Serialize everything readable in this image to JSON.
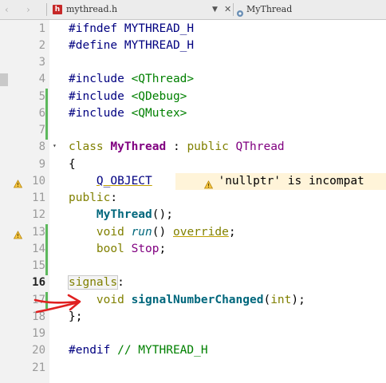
{
  "tab": {
    "back": "‹",
    "forward": "›",
    "file_icon": "h",
    "filename": "mythread.h",
    "dropdown": "▼",
    "close": "✕",
    "symbol": "MyThread"
  },
  "lines": [
    {
      "n": "1",
      "segs": [
        {
          "t": "#ifndef ",
          "c": "pp"
        },
        {
          "t": "MYTHREAD_H",
          "c": "mac"
        }
      ]
    },
    {
      "n": "2",
      "segs": [
        {
          "t": "#define ",
          "c": "pp"
        },
        {
          "t": "MYTHREAD_H",
          "c": "mac"
        }
      ]
    },
    {
      "n": "3",
      "segs": []
    },
    {
      "n": "4",
      "segs": [
        {
          "t": "#include ",
          "c": "pp"
        },
        {
          "t": "<QThread>",
          "c": "inc"
        }
      ]
    },
    {
      "n": "5",
      "segs": [
        {
          "t": "#include ",
          "c": "pp"
        },
        {
          "t": "<QDebug>",
          "c": "inc"
        }
      ]
    },
    {
      "n": "6",
      "segs": [
        {
          "t": "#include ",
          "c": "pp"
        },
        {
          "t": "<QMutex>",
          "c": "inc"
        }
      ]
    },
    {
      "n": "7",
      "segs": []
    },
    {
      "n": "8",
      "fold": "▾",
      "segs": [
        {
          "t": "class ",
          "c": "kw"
        },
        {
          "t": "MyThread",
          "c": "cls"
        },
        {
          "t": " : "
        },
        {
          "t": "public ",
          "c": "kw"
        },
        {
          "t": "QThread",
          "c": "cls2"
        }
      ]
    },
    {
      "n": "9",
      "segs": [
        {
          "t": "{"
        }
      ]
    },
    {
      "n": "10",
      "warn": true,
      "segs": [
        {
          "t": "    "
        },
        {
          "t": "Q_OBJECT",
          "c": "mac",
          "u": true
        }
      ],
      "note": "  'nullptr' is incompat"
    },
    {
      "n": "11",
      "segs": [
        {
          "t": "public",
          "c": "kw"
        },
        {
          "t": ":"
        }
      ]
    },
    {
      "n": "12",
      "segs": [
        {
          "t": "    "
        },
        {
          "t": "MyThread",
          "c": "fn"
        },
        {
          "t": "();"
        }
      ]
    },
    {
      "n": "13",
      "warn": true,
      "segs": [
        {
          "t": "    "
        },
        {
          "t": "void ",
          "c": "kw"
        },
        {
          "t": "run",
          "c": "vfn"
        },
        {
          "t": "() "
        },
        {
          "t": "override",
          "c": "kw",
          "u": true
        },
        {
          "t": ";"
        }
      ]
    },
    {
      "n": "14",
      "segs": [
        {
          "t": "    "
        },
        {
          "t": "bool ",
          "c": "kw"
        },
        {
          "t": "Stop",
          "c": "cls2"
        },
        {
          "t": ";"
        }
      ]
    },
    {
      "n": "15",
      "segs": []
    },
    {
      "n": "16",
      "bold": true,
      "segs": [
        {
          "t": "signals",
          "c": "kw sig"
        },
        {
          "t": ":"
        }
      ]
    },
    {
      "n": "17",
      "segs": [
        {
          "t": "    "
        },
        {
          "t": "void ",
          "c": "kw"
        },
        {
          "t": "signalNumberChanged",
          "c": "fn"
        },
        {
          "t": "("
        },
        {
          "t": "int",
          "c": "kw"
        },
        {
          "t": ");"
        }
      ]
    },
    {
      "n": "18",
      "segs": [
        {
          "t": "};"
        }
      ]
    },
    {
      "n": "19",
      "segs": []
    },
    {
      "n": "20",
      "segs": [
        {
          "t": "#endif ",
          "c": "pp"
        },
        {
          "t": "// MYTHREAD_H",
          "c": "cmt"
        }
      ]
    },
    {
      "n": "21",
      "segs": []
    }
  ]
}
